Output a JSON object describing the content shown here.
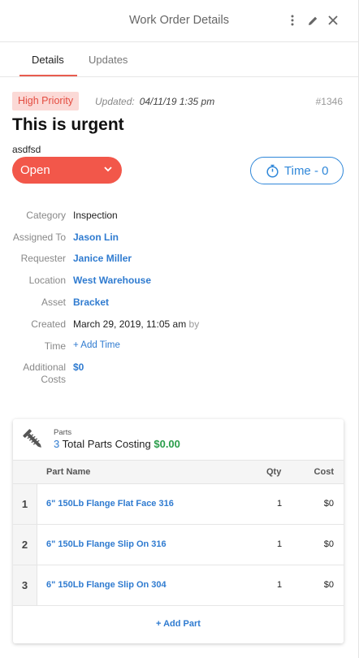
{
  "header": {
    "title": "Work Order Details",
    "more_icon": "more-vertical-icon",
    "edit_icon": "pencil-icon",
    "close_icon": "close-icon"
  },
  "tabs": [
    {
      "label": "Details",
      "active": true
    },
    {
      "label": "Updates",
      "active": false
    }
  ],
  "work_order": {
    "priority": "High Priority",
    "updated_label": "Updated:",
    "updated_value": "04/11/19 1:35 pm",
    "id": "#1346",
    "title": "This is urgent",
    "description": "asdfsd",
    "status": "Open",
    "time_button": "Time - 0"
  },
  "fields": {
    "category": {
      "label": "Category",
      "value": "Inspection"
    },
    "assigned_to": {
      "label": "Assigned To",
      "value": "Jason Lin"
    },
    "requester": {
      "label": "Requester",
      "value": "Janice Miller"
    },
    "location": {
      "label": "Location",
      "value": "West Warehouse"
    },
    "asset": {
      "label": "Asset",
      "value": "Bracket"
    },
    "created": {
      "label": "Created",
      "value": "March 29, 2019, 11:05 am",
      "suffix": "by"
    },
    "time": {
      "label": "Time",
      "value": "+ Add Time"
    },
    "additional_costs": {
      "label_line1": "Additional",
      "label_line2": "Costs",
      "value": "$0"
    }
  },
  "parts": {
    "kicker": "Parts",
    "count": "3",
    "summary_text": "Total Parts Costing",
    "total": "$0.00",
    "columns": {
      "name": "Part Name",
      "qty": "Qty",
      "cost": "Cost"
    },
    "rows": [
      {
        "index": "1",
        "name": "6\" 150Lb Flange Flat Face 316",
        "qty": "1",
        "cost": "$0"
      },
      {
        "index": "2",
        "name": "6\" 150Lb Flange Slip On 316",
        "qty": "1",
        "cost": "$0"
      },
      {
        "index": "3",
        "name": "6\" 150Lb Flange Slip On 304",
        "qty": "1",
        "cost": "$0"
      }
    ],
    "add_label": "+ Add Part"
  },
  "colors": {
    "accent_red": "#f2574a",
    "link_blue": "#2f7bd0",
    "money_green": "#2a9d4a",
    "priority_bg": "#fbd9d6"
  }
}
